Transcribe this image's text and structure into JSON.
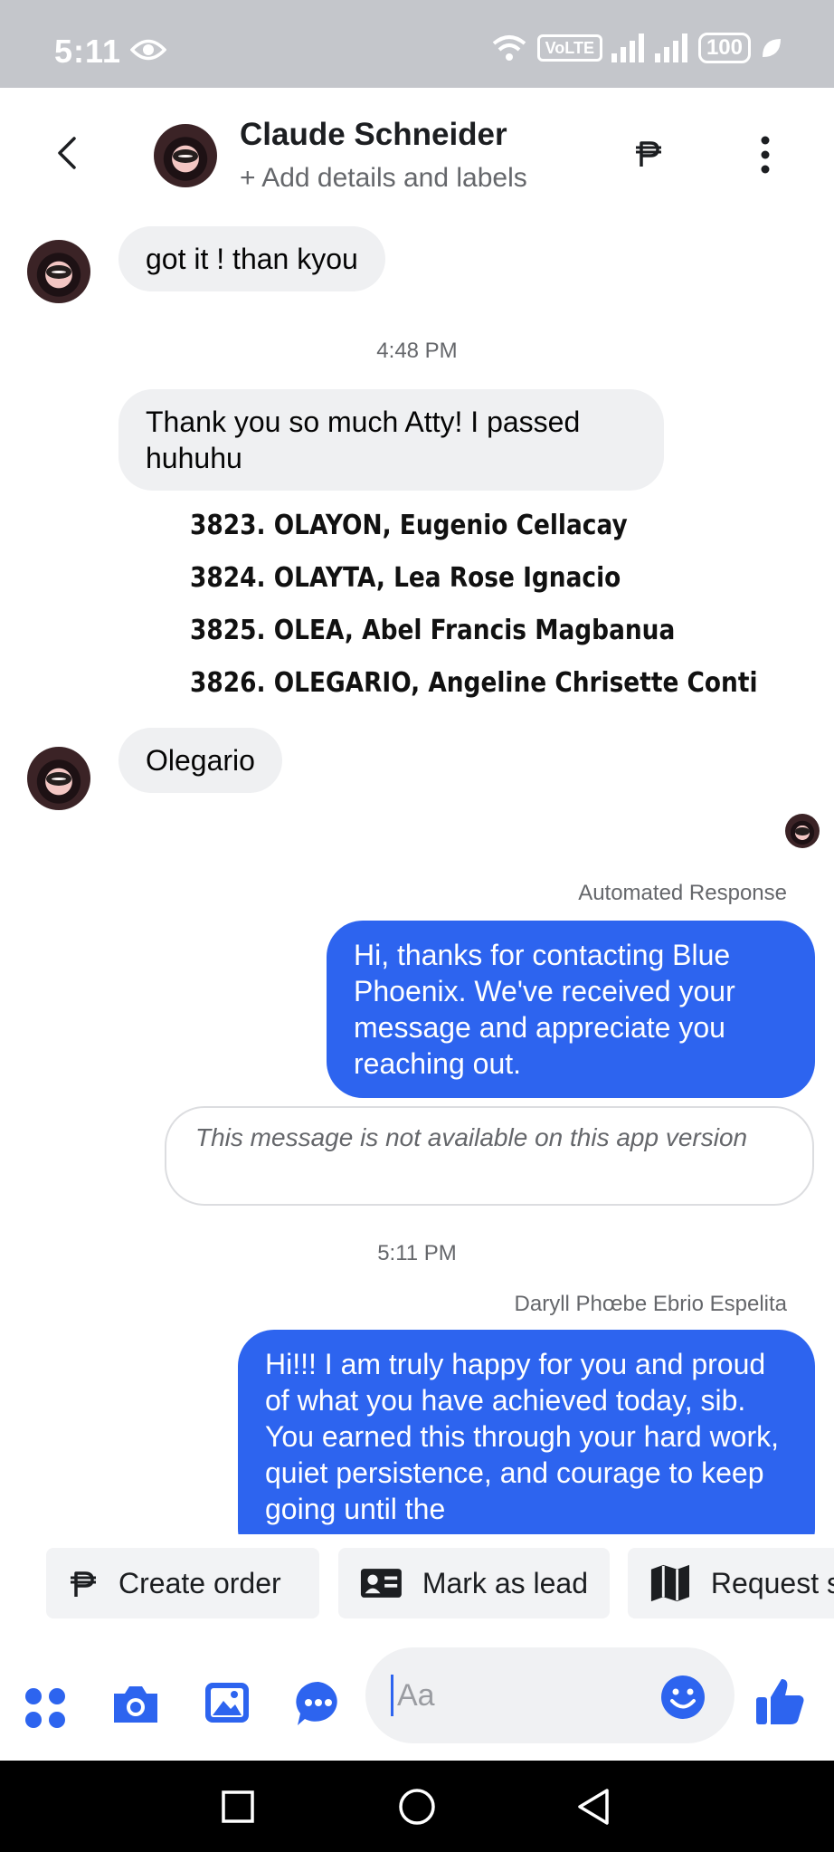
{
  "status_bar": {
    "time": "5:11",
    "volte": "VoLTE",
    "battery": "100"
  },
  "header": {
    "contact_name": "Claude Schneider",
    "subtitle": "+ Add details and labels"
  },
  "messages": {
    "m1": "got it ! than kyou",
    "ts1": "4:48 PM",
    "m2": "Thank you so much Atty! I passed huhuhu",
    "m3": "Olegario",
    "auto_label": "Automated Response",
    "m4": "Hi, thanks for contacting Blue Phoenix. We've received your message and appreciate you reaching out.",
    "unavailable": "This message is not available on this app version",
    "ts2": "5:11 PM",
    "sender2": "Daryll Phœbe Ebrio Espelita",
    "m5": "Hi!!! I am truly happy for you and proud of what you have achieved today, sib. You earned this through your hard work, quiet persistence, and courage to keep going until the"
  },
  "attachment_lines": [
    "3823. OLAYON, Eugenio Cellacay",
    "3824. OLAYTA, Lea Rose Ignacio",
    "3825. OLEA, Abel Francis Magbanua",
    "3826. OLEGARIO, Angeline Chrisette Conti"
  ],
  "quick_actions": {
    "create_order": "Create order",
    "mark_as_lead": "Mark as lead",
    "request": "Request s"
  },
  "composer": {
    "placeholder": "Aa"
  },
  "colors": {
    "accent": "#2d64ef",
    "incoming_bubble": "#eff0f2",
    "status_bar": "#c4c6cb"
  }
}
